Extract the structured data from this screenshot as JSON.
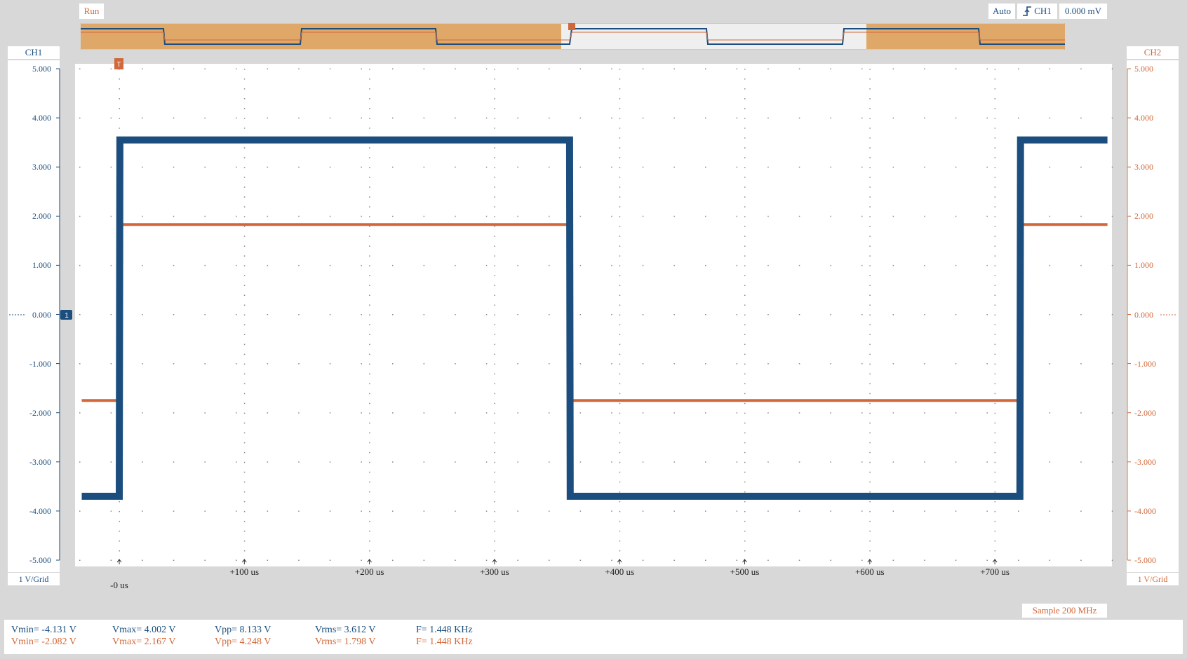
{
  "header": {
    "run_label": "Run",
    "trigger_mode": "Auto",
    "trigger_source": "CH1",
    "trigger_level": "0.000 mV",
    "trigger_marker": "T"
  },
  "ch1": {
    "label": "CH1",
    "scale": "1 V/Grid",
    "offset_marker": "1",
    "color": "#1b4e7e"
  },
  "ch2": {
    "label": "CH2",
    "scale": "1 V/Grid",
    "color": "#d2683a"
  },
  "y_ticks": [
    "5.000",
    "4.000",
    "3.000",
    "2.000",
    "1.000",
    "0.000",
    "-1.000",
    "-2.000",
    "-3.000",
    "-4.000",
    "-5.000"
  ],
  "x_ticks": [
    "-0 us",
    "+100 us",
    "+200 us",
    "+300 us",
    "+400 us",
    "+500 us",
    "+600 us",
    "+700 us"
  ],
  "sample_rate": "Sample 200 MHz",
  "measurements": {
    "ch1": {
      "vmin": "Vmin= -4.131 V",
      "vmax": "Vmax= 4.002 V",
      "vpp": "Vpp= 8.133 V",
      "vrms": "Vrms= 3.612 V",
      "freq": "F= 1.448 KHz"
    },
    "ch2": {
      "vmin": "Vmin= -2.082 V",
      "vmax": "Vmax= 2.167 V",
      "vpp": "Vpp= 4.248 V",
      "vrms": "Vrms= 1.798 V",
      "freq": "F= 1.448 KHz"
    }
  },
  "chart_data": {
    "type": "line",
    "x_unit": "us",
    "xlim": [
      -30,
      790
    ],
    "ylim": [
      -5,
      5
    ],
    "grid": true,
    "series": [
      {
        "name": "CH1",
        "x": [
          -30,
          0,
          0.5,
          360,
          360.5,
          720,
          720.5,
          790
        ],
        "values": [
          -3.7,
          -3.7,
          3.55,
          3.55,
          -3.7,
          -3.7,
          3.55,
          3.55
        ]
      },
      {
        "name": "CH2",
        "x": [
          -30,
          0,
          0.5,
          360,
          360.5,
          720,
          720.5,
          790
        ],
        "values": [
          -1.75,
          -1.75,
          1.83,
          1.83,
          -1.75,
          -1.75,
          1.83,
          1.83
        ]
      }
    ]
  }
}
